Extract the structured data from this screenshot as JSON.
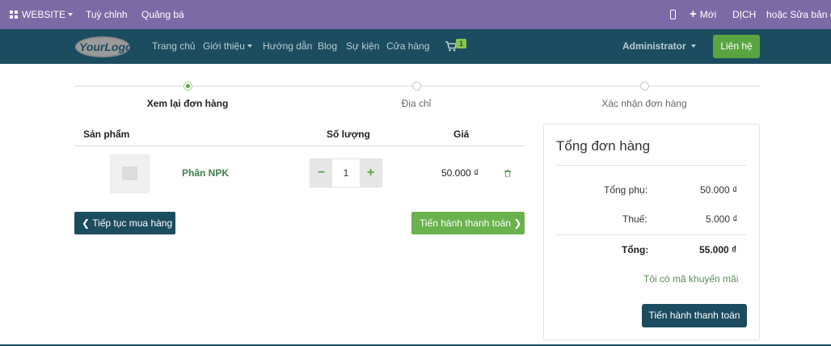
{
  "admin_bar": {
    "website_menu": "WEBSITE",
    "customize": "Tuỳ chỉnh",
    "promote": "Quảng bá",
    "new_label": "Mới",
    "translate": "DỊCH",
    "edit_text": "hoặc Sửa bản gố"
  },
  "navbar": {
    "logo_text": "YourLogo",
    "links": [
      "Trang chủ",
      "Giới thiệu",
      "Hướng dẫn",
      "Blog",
      "Sự kiện",
      "Cửa hàng"
    ],
    "cart_count": "1",
    "user": "Administrator",
    "contact": "Liên hệ"
  },
  "steps": {
    "review": "Xem lại đơn hàng",
    "address": "Địa chỉ",
    "confirm": "Xác nhận đơn hàng"
  },
  "cart": {
    "headers": {
      "product": "Sản phẩm",
      "quantity": "Số lượng",
      "price": "Giá"
    },
    "items": [
      {
        "name": "Phân NPK",
        "quantity": "1",
        "price": "50.000 ₫"
      }
    ],
    "continue_label": "Tiếp tục mua hàng",
    "checkout_label": "Tiến hành thanh toán"
  },
  "summary": {
    "title": "Tổng đơn hàng",
    "subtotal_label": "Tổng phụ:",
    "subtotal_value": "50.000 ₫",
    "tax_label": "Thuế:",
    "tax_value": "5.000 ₫",
    "total_label": "Tổng:",
    "total_value": "55.000 ₫",
    "promo_link": "Tôi có mã khuyến mãi",
    "checkout_label": "Tiến hành thanh toán"
  },
  "colors": {
    "admin_bar": "#7c6aa6",
    "navbar": "#1c4c5f",
    "accent_green": "#5aa542",
    "link_green": "#3e7e4c"
  }
}
